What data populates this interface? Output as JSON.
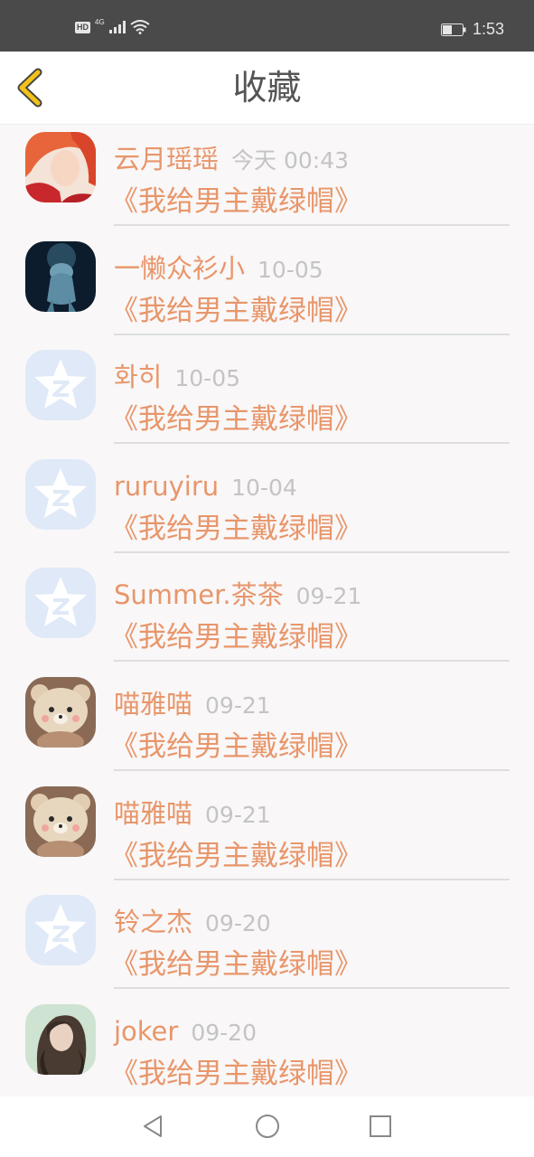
{
  "status_bar": {
    "hd": "HD",
    "network": "4G",
    "time": "1:53",
    "icons": [
      "signal-icon",
      "wifi-icon",
      "battery-icon"
    ]
  },
  "header": {
    "title": "收藏",
    "back_icon": "chevron-left-icon",
    "accent_color": "#f2c21a"
  },
  "colors": {
    "name": "#e8966a",
    "time": "#c4c4c4",
    "book": "#e8966a"
  },
  "items": [
    {
      "name": "云月瑶瑶",
      "time": "今天 00:43",
      "book": "《我给男主戴绿帽》",
      "avatar": "anime-avatar"
    },
    {
      "name": "一懒众衫小",
      "time": "10-05",
      "book": "《我给男主戴绿帽》",
      "avatar": "underwater-avatar"
    },
    {
      "name": "화히",
      "time": "10-05",
      "book": "《我给男主戴绿帽》",
      "avatar": "qq-default-avatar"
    },
    {
      "name": "ruruyiru",
      "time": "10-04",
      "book": "《我给男主戴绿帽》",
      "avatar": "qq-default-avatar"
    },
    {
      "name": "Summer.茶茶",
      "time": "09-21",
      "book": "《我给男主戴绿帽》",
      "avatar": "qq-default-avatar"
    },
    {
      "name": "喵雅喵",
      "time": "09-21",
      "book": "《我给男主戴绿帽》",
      "avatar": "bear-avatar"
    },
    {
      "name": "喵雅喵",
      "time": "09-21",
      "book": "《我给男主戴绿帽》",
      "avatar": "bear-avatar"
    },
    {
      "name": "铃之杰",
      "time": "09-20",
      "book": "《我给男主戴绿帽》",
      "avatar": "qq-default-avatar"
    },
    {
      "name": "joker",
      "time": "09-20",
      "book": "《我给男主戴绿帽》",
      "avatar": "girl-avatar"
    }
  ],
  "nav_bar": {
    "icons": [
      "back-triangle-icon",
      "home-circle-icon",
      "recents-square-icon"
    ]
  }
}
